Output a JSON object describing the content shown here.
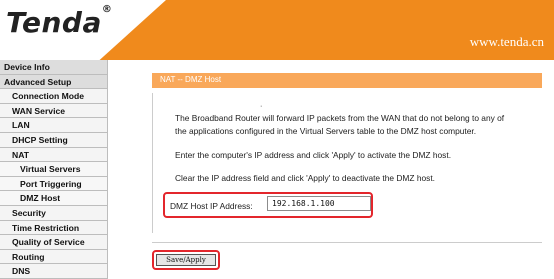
{
  "brand": {
    "logo": "Tenda",
    "registered": "®",
    "url": "www.tenda.cn"
  },
  "sidebar": {
    "items": [
      {
        "label": "Device Info"
      },
      {
        "label": "Advanced Setup"
      },
      {
        "label": "Connection Mode"
      },
      {
        "label": "WAN Service"
      },
      {
        "label": "LAN"
      },
      {
        "label": "DHCP Setting"
      },
      {
        "label": "NAT"
      },
      {
        "label": "Virtual Servers"
      },
      {
        "label": "Port Triggering"
      },
      {
        "label": "DMZ Host"
      },
      {
        "label": "Security"
      },
      {
        "label": "Time Restriction"
      },
      {
        "label": "Quality of Service"
      },
      {
        "label": "Routing"
      },
      {
        "label": "DNS"
      }
    ]
  },
  "page": {
    "title": "NAT -- DMZ Host",
    "dot": "·",
    "description_line1": "The Broadband Router will forward IP packets from the WAN that do not belong to any of",
    "description_line2": "the applications configured in the Virtual Servers table to the DMZ host computer.",
    "instruction_activate": "Enter the computer's IP address and click 'Apply' to activate the DMZ host.",
    "instruction_deactivate": "Clear the IP address field and click 'Apply' to deactivate the DMZ host.",
    "field_label": "DMZ Host IP Address:",
    "field_value": "192.168.1.100",
    "button_label": "Save/Apply"
  },
  "colors": {
    "header": "#f08a1c",
    "title_bar": "#f9a85a",
    "highlight": "#e3262c"
  }
}
